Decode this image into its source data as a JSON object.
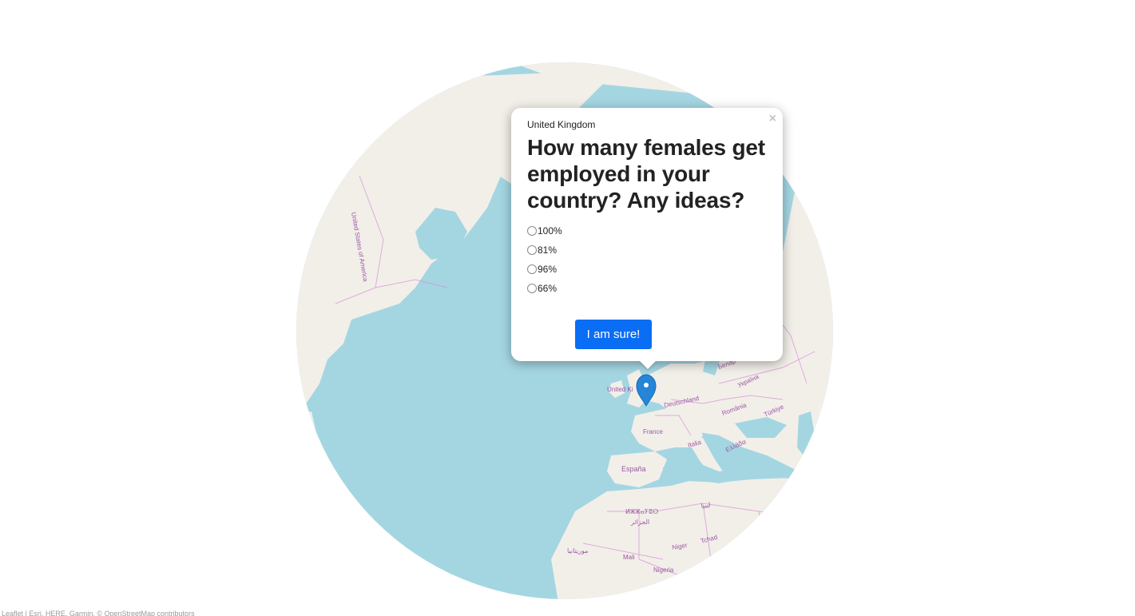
{
  "map": {
    "labels": {
      "united_states": "United States of America",
      "united_kingdom_short": "United Ki",
      "deutschland": "Deutschland",
      "france": "France",
      "espana": "España",
      "italia": "Italia",
      "romania": "România",
      "turkiye": "Türkiye",
      "ukraina": "Україна",
      "ellada": "Ελλάδα",
      "algerie_ar": "الجزائر",
      "algerie_tz": "ⵍⵣⵣⴰⵢⴻⵔ",
      "mali": "Mali",
      "niger": "Niger",
      "tchad": "Tchad",
      "nigeria": "Nigeria",
      "libya": "ليبيا",
      "mauritania": "موريتانيا",
      "belarus": "Белар"
    },
    "colors": {
      "ocean": "#a4d6e2",
      "land": "#f2efe9",
      "border": "#d68fd6",
      "marker": "#2585d6"
    },
    "attribution": "Leaflet | Esri, HERE, Garmin, © OpenStreetMap contributors"
  },
  "popup": {
    "country": "United Kingdom",
    "question": "How many females get employed in your country? Any ideas?",
    "close_label": "×",
    "options": [
      "100%",
      "81%",
      "96%",
      "66%"
    ],
    "submit_label": "I am sure!"
  }
}
